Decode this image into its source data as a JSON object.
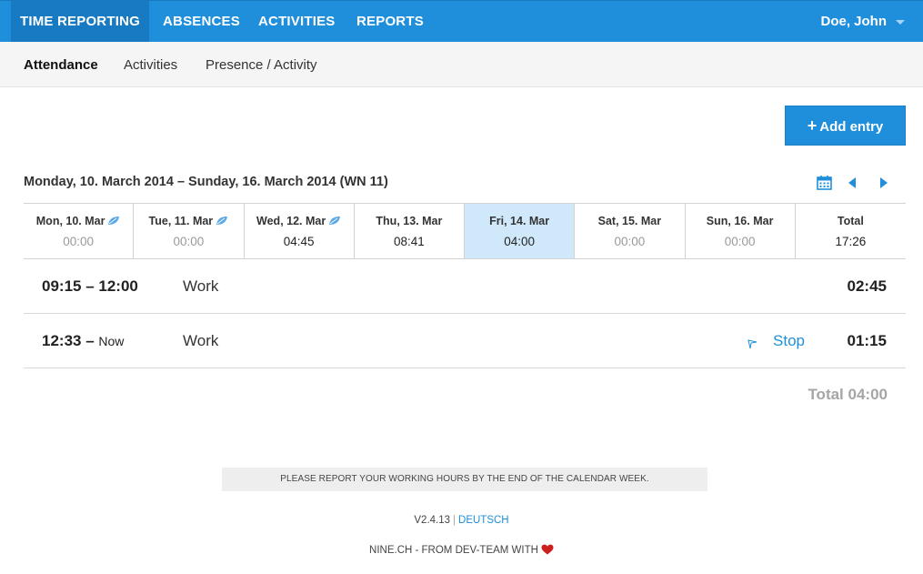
{
  "topnav": {
    "items": [
      {
        "label": "TIME REPORTING",
        "active": true
      },
      {
        "label": "ABSENCES",
        "active": false
      },
      {
        "label": "ACTIVITIES",
        "active": false
      },
      {
        "label": "REPORTS",
        "active": false
      }
    ],
    "user": "Doe, John"
  },
  "subnav": {
    "items": [
      {
        "label": "Attendance",
        "active": true
      },
      {
        "label": "Activities",
        "active": false
      },
      {
        "label": "Presence / Activity",
        "active": false
      }
    ]
  },
  "add_entry": {
    "icon": "plus-icon",
    "label": "Add entry"
  },
  "week": {
    "title": "Monday, 10. March 2014 – Sunday, 16. March 2014 (WN 11)",
    "controls": [
      "calendar-icon",
      "prev-arrow-icon",
      "next-arrow-icon"
    ],
    "days": [
      {
        "name": "Mon, 10. Mar",
        "value": "00:00",
        "leaf": true,
        "selected": false
      },
      {
        "name": "Tue, 11. Mar",
        "value": "00:00",
        "leaf": true,
        "selected": false
      },
      {
        "name": "Wed, 12. Mar",
        "value": "04:45",
        "leaf": true,
        "selected": false
      },
      {
        "name": "Thu, 13. Mar",
        "value": "08:41",
        "leaf": false,
        "selected": false
      },
      {
        "name": "Fri, 14. Mar",
        "value": "04:00",
        "leaf": false,
        "selected": true
      },
      {
        "name": "Sat, 15. Mar",
        "value": "00:00",
        "leaf": false,
        "selected": false
      },
      {
        "name": "Sun, 16. Mar",
        "value": "00:00",
        "leaf": false,
        "selected": false
      },
      {
        "name": "Total",
        "value": "17:26",
        "leaf": false,
        "selected": false
      }
    ]
  },
  "entries": [
    {
      "start": "09:15",
      "sep": " – ",
      "end": "12:00",
      "kind": "Work",
      "duration": "02:45"
    },
    {
      "start": "12:33",
      "sep": " – ",
      "end": "Now",
      "kind": "Work",
      "stop_label": "Stop",
      "duration": "01:15"
    }
  ],
  "total": "Total 04:00",
  "footer": {
    "notice": "PLEASE REPORT YOUR WORKING HOURS BY THE END OF THE CALENDAR WEEK.",
    "version": "V2.4.13",
    "divider": "|",
    "language_link": "DEUTSCH",
    "credits": "NINE.CH - FROM DEV-TEAM WITH",
    "heart_color": "#cc1f1f"
  },
  "colors": {
    "accent": "#1f8fdb",
    "selected_day": "#cfe9fb"
  }
}
